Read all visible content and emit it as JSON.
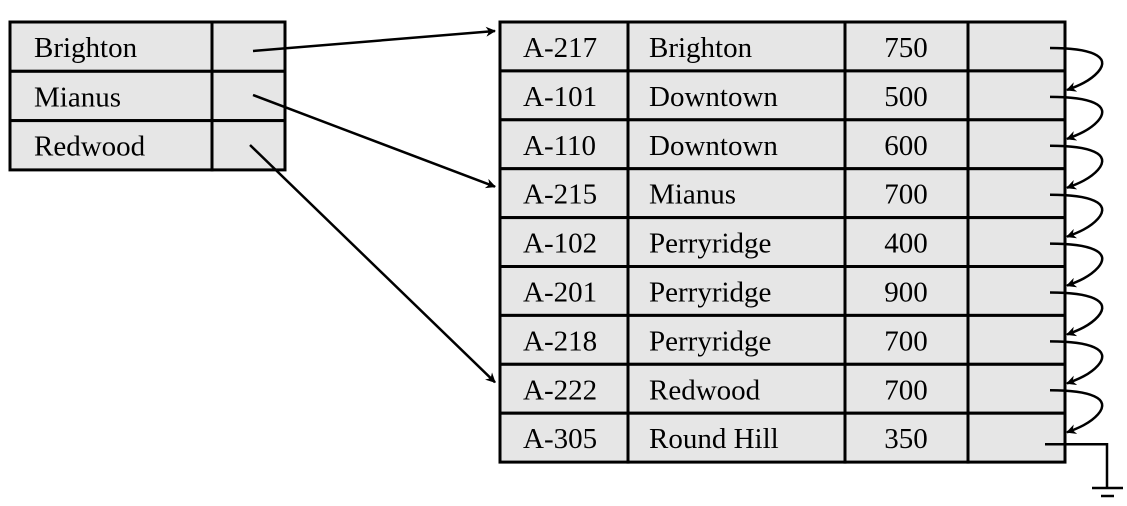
{
  "index": {
    "entries": [
      {
        "key": "Brighton",
        "points_to_row": 0
      },
      {
        "key": "Mianus",
        "points_to_row": 3
      },
      {
        "key": "Redwood",
        "points_to_row": 7
      }
    ]
  },
  "records": [
    {
      "account": "A-217",
      "branch": "Brighton",
      "balance": "750"
    },
    {
      "account": "A-101",
      "branch": "Downtown",
      "balance": "500"
    },
    {
      "account": "A-110",
      "branch": "Downtown",
      "balance": "600"
    },
    {
      "account": "A-215",
      "branch": "Mianus",
      "balance": "700"
    },
    {
      "account": "A-102",
      "branch": "Perryridge",
      "balance": "400"
    },
    {
      "account": "A-201",
      "branch": "Perryridge",
      "balance": "900"
    },
    {
      "account": "A-218",
      "branch": "Perryridge",
      "balance": "700"
    },
    {
      "account": "A-222",
      "branch": "Redwood",
      "balance": "700"
    },
    {
      "account": "A-305",
      "branch": "Round Hill",
      "balance": "350"
    }
  ],
  "colors": {
    "cell_fill": "#e6e6e6",
    "line": "#000000"
  }
}
